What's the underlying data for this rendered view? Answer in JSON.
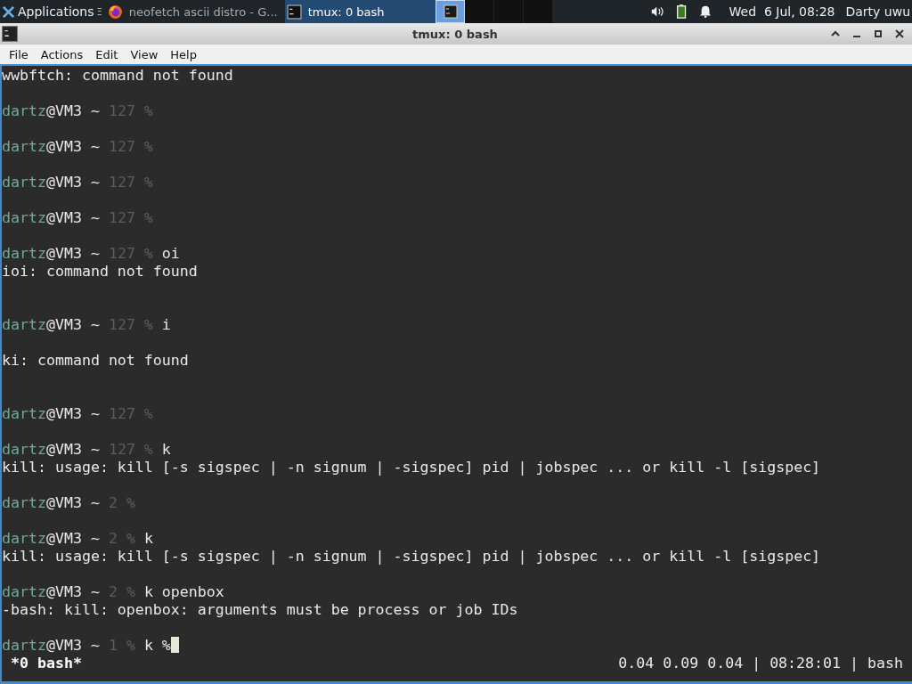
{
  "panel": {
    "apps_label": "Applications",
    "apps_glyph": "Ξ",
    "tasks": [
      {
        "label": "neofetch ascii distro - G...",
        "kind": "browser",
        "selected": false
      },
      {
        "label": "tmux: 0 bash",
        "kind": "terminal",
        "selected": true
      }
    ],
    "workspaces": [
      {
        "selected": true,
        "has_window": true
      },
      {
        "selected": false,
        "has_window": false
      },
      {
        "selected": false,
        "has_window": false
      },
      {
        "selected": false,
        "has_window": false
      }
    ],
    "clock": "Wed  6 Jul, 08:28",
    "user": "Darty uwu"
  },
  "window": {
    "title": "tmux: 0 bash"
  },
  "menu": [
    "File",
    "Actions",
    "Edit",
    "View",
    "Help"
  ],
  "terminal": {
    "lines": [
      {
        "kind": "output",
        "text": "wwbftch: command not found"
      },
      {
        "kind": "blank"
      },
      {
        "kind": "prompt",
        "user": "dartz",
        "host": "@VM3 ~",
        "status": "127 %"
      },
      {
        "kind": "blank"
      },
      {
        "kind": "prompt",
        "user": "dartz",
        "host": "@VM3 ~",
        "status": "127 %"
      },
      {
        "kind": "blank"
      },
      {
        "kind": "prompt",
        "user": "dartz",
        "host": "@VM3 ~",
        "status": "127 %"
      },
      {
        "kind": "blank"
      },
      {
        "kind": "prompt",
        "user": "dartz",
        "host": "@VM3 ~",
        "status": "127 %"
      },
      {
        "kind": "blank"
      },
      {
        "kind": "prompt",
        "user": "dartz",
        "host": "@VM3 ~",
        "status": "127 %",
        "command": "oi"
      },
      {
        "kind": "output",
        "text": "ioi: command not found"
      },
      {
        "kind": "blank"
      },
      {
        "kind": "blank"
      },
      {
        "kind": "prompt",
        "user": "dartz",
        "host": "@VM3 ~",
        "status": "127 %",
        "command": "i"
      },
      {
        "kind": "blank"
      },
      {
        "kind": "output",
        "text": "ki: command not found"
      },
      {
        "kind": "blank"
      },
      {
        "kind": "blank"
      },
      {
        "kind": "prompt",
        "user": "dartz",
        "host": "@VM3 ~",
        "status": "127 %"
      },
      {
        "kind": "blank"
      },
      {
        "kind": "prompt",
        "user": "dartz",
        "host": "@VM3 ~",
        "status": "127 %",
        "command": "k"
      },
      {
        "kind": "output",
        "text": "kill: usage: kill [-s sigspec | -n signum | -sigspec] pid | jobspec ... or kill -l [sigspec]"
      },
      {
        "kind": "blank"
      },
      {
        "kind": "prompt",
        "user": "dartz",
        "host": "@VM3 ~",
        "status": "2 %"
      },
      {
        "kind": "blank"
      },
      {
        "kind": "prompt",
        "user": "dartz",
        "host": "@VM3 ~",
        "status": "2 %",
        "command": "k"
      },
      {
        "kind": "output",
        "text": "kill: usage: kill [-s sigspec | -n signum | -sigspec] pid | jobspec ... or kill -l [sigspec]"
      },
      {
        "kind": "blank"
      },
      {
        "kind": "prompt",
        "user": "dartz",
        "host": "@VM3 ~",
        "status": "2 %",
        "command": "k openbox"
      },
      {
        "kind": "output",
        "text": "-bash: kill: openbox: arguments must be process or job IDs"
      },
      {
        "kind": "blank"
      },
      {
        "kind": "prompt",
        "user": "dartz",
        "host": "@VM3 ~",
        "status": "1 %",
        "command": "k %",
        "cursor": true
      }
    ],
    "status_left": "*0 bash*",
    "status_right": "0.04 0.09 0.04 | 08:28:01 | bash"
  }
}
